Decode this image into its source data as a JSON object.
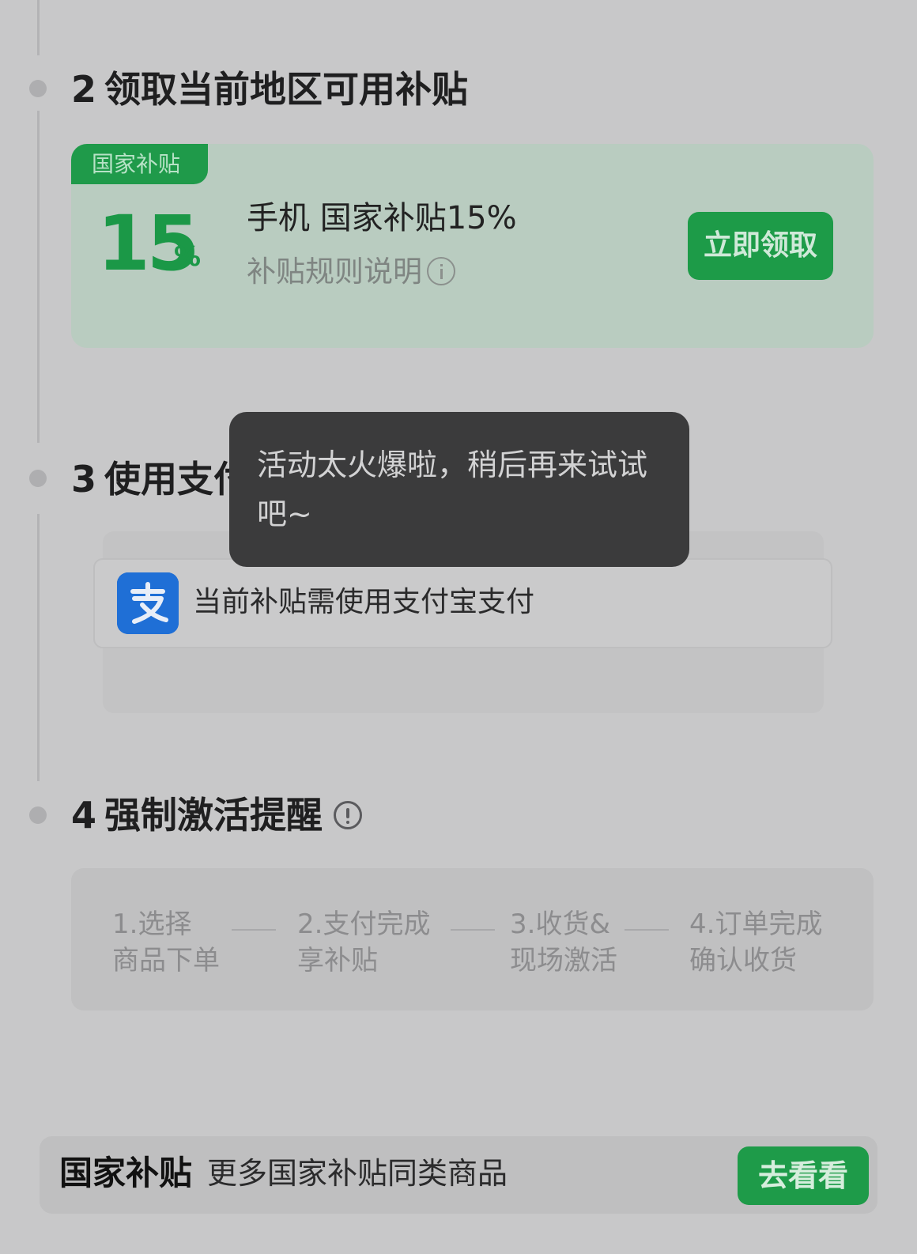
{
  "step2": {
    "num": "2",
    "title": "领取当前地区可用补贴"
  },
  "subsidy": {
    "tag": "国家补贴",
    "percent": "15",
    "percent_sign": "%",
    "name": "手机 国家补贴15%",
    "rule": "补贴规则说明",
    "claim_label": "立即领取"
  },
  "step3": {
    "num": "3",
    "title": "使用支付宝支付"
  },
  "alipay": {
    "text": "当前补贴需使用支付宝支付",
    "logo_color": "#1677FF"
  },
  "step4": {
    "num": "4",
    "title": "强制激活提醒"
  },
  "flow": [
    {
      "line1": "1.选择",
      "line2": "商品下单"
    },
    {
      "line1": "2.支付完成",
      "line2": "享补贴"
    },
    {
      "line1": "3.收货&",
      "line2": "现场激活"
    },
    {
      "line1": "4.订单完成",
      "line2": "确认收货"
    }
  ],
  "bottom": {
    "brand": "国家补贴",
    "desc": "更多国家补贴同类商品",
    "button": "去看看"
  },
  "toast": {
    "message": "活动太火爆啦，稍后再来试试吧~"
  },
  "colors": {
    "accent": "#1E9B49",
    "toast_bg": "#3B3B3C"
  }
}
